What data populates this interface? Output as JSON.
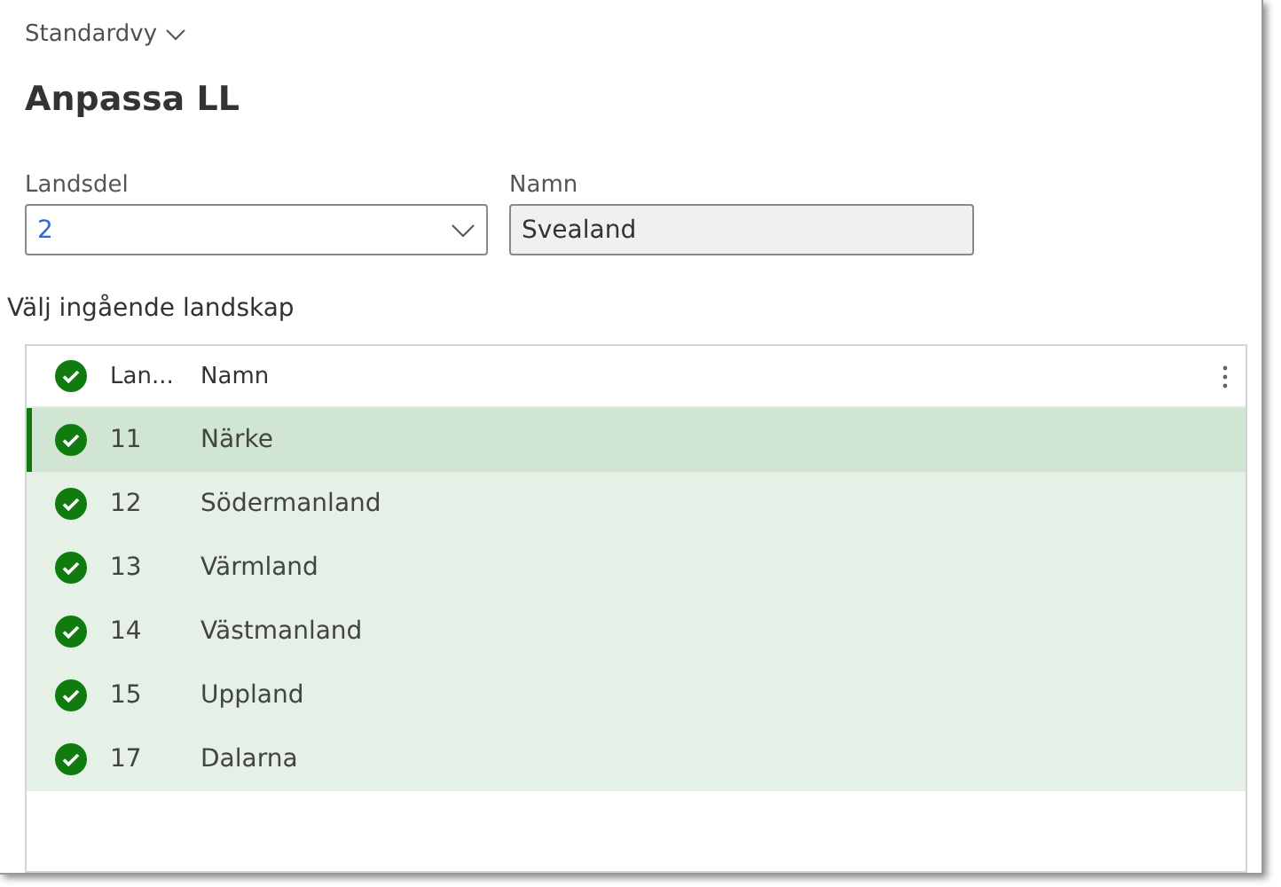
{
  "view_selector": {
    "label": "Standardvy",
    "expanded": false
  },
  "title": "Anpassa LL",
  "fields": [
    {
      "kind": "dropdown",
      "label": "Landsdel",
      "value": "2"
    },
    {
      "kind": "readonly",
      "label": "Namn",
      "value": "Svealand"
    }
  ],
  "section_title": "Välj ingående landskap",
  "table": {
    "select_all": true,
    "columns": [
      "Lan...",
      "Namn"
    ],
    "rows": [
      {
        "cells": [
          "11",
          "Närke"
        ],
        "selected": true,
        "current": true
      },
      {
        "cells": [
          "12",
          "Södermanland"
        ],
        "selected": true,
        "current": false
      },
      {
        "cells": [
          "13",
          "Värmland"
        ],
        "selected": true,
        "current": false
      },
      {
        "cells": [
          "14",
          "Västmanland"
        ],
        "selected": true,
        "current": false
      },
      {
        "cells": [
          "15",
          "Uppland"
        ],
        "selected": true,
        "current": false
      },
      {
        "cells": [
          "17",
          "Dalarna"
        ],
        "selected": true,
        "current": false
      }
    ]
  }
}
